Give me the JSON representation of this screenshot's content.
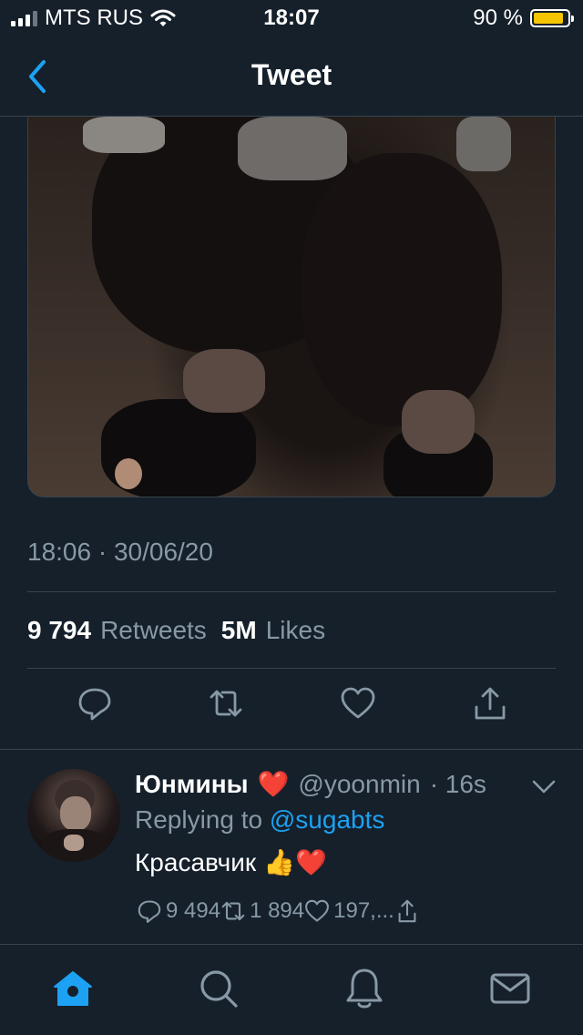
{
  "status_bar": {
    "carrier": "MTS RUS",
    "time": "18:07",
    "battery": "90 %",
    "battery_level": 0.9
  },
  "nav": {
    "title": "Tweet",
    "back_icon": "chevron-left-icon"
  },
  "tweet": {
    "timestamp": "18:06 · 30/06/20",
    "retweets_count": "9 794",
    "retweets_label": "Retweets",
    "likes_count": "5M",
    "likes_label": "Likes"
  },
  "actions": [
    "reply-icon",
    "retweet-icon",
    "like-icon",
    "share-icon"
  ],
  "reply": {
    "name": "Юнмины",
    "name_emoji": "❤️",
    "handle": "@yoonmin",
    "time": "· 16s",
    "replying_prefix": "Replying to",
    "replying_to": "@sugabts",
    "text": "Красавчик",
    "text_emoji": "👍❤️",
    "reply_count": "9 494",
    "retweet_count": "1 894",
    "like_count": "197,..."
  },
  "tabs": [
    "home-icon",
    "search-icon",
    "notifications-icon",
    "messages-icon"
  ],
  "colors": {
    "background": "#15202b",
    "accent": "#1da1f2",
    "secondary_text": "#8899a6",
    "divider": "#38444d",
    "battery": "#f5c400"
  }
}
